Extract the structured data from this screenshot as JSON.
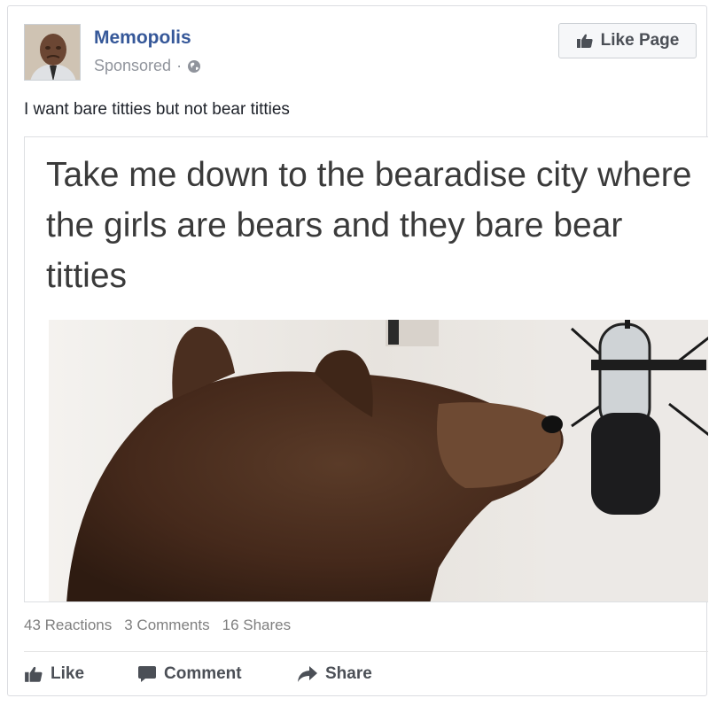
{
  "post": {
    "page_name": "Memopolis",
    "sponsored_label": "Sponsored",
    "separator": "·",
    "audience_icon": "globe-icon",
    "like_page_label": "Like Page",
    "text": "I want bare titties but not bear titties"
  },
  "media": {
    "caption": "Take me down to the bearadise city where the girls are bears and they bare bear titties",
    "photo_subject": "bear-at-microphone"
  },
  "stats": {
    "reactions": "43 Reactions",
    "comments": "3 Comments",
    "shares": "16 Shares"
  },
  "actions": {
    "like_label": "Like",
    "comment_label": "Comment",
    "share_label": "Share"
  },
  "colors": {
    "brand_blue": "#365899",
    "meta_gray": "#90949c",
    "action_gray": "#4b4f56"
  }
}
